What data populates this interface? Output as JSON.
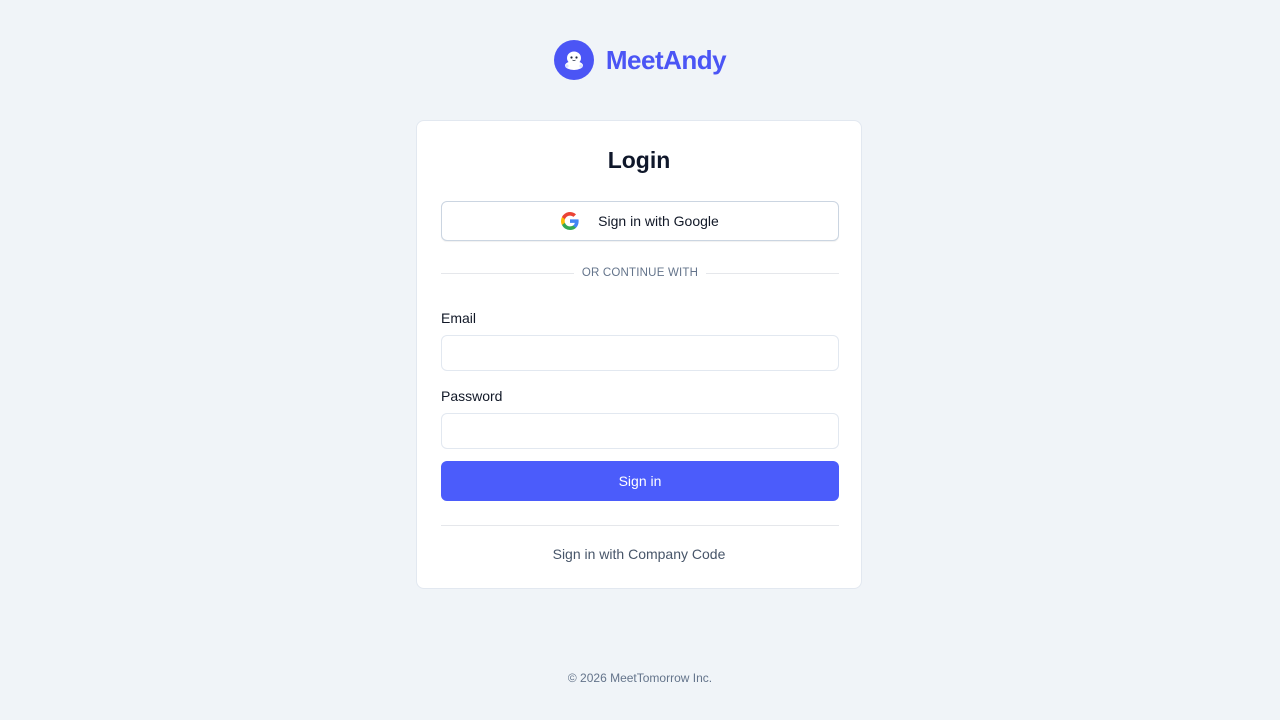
{
  "brand": {
    "name": "MeetAndy",
    "logo_icon": "mascot-icon",
    "color": "#4b55f5"
  },
  "login": {
    "title": "Login",
    "google_button_label": "Sign in with Google",
    "google_icon": "google-icon",
    "divider_text": "OR CONTINUE WITH",
    "email_label": "Email",
    "email_value": "",
    "email_placeholder": "",
    "password_label": "Password",
    "password_value": "",
    "password_placeholder": "",
    "submit_label": "Sign in",
    "submit_color": "#4b5cfb",
    "company_code_link": "Sign in with Company Code"
  },
  "footer": {
    "copyright": "© 2026 MeetTomorrow Inc."
  }
}
